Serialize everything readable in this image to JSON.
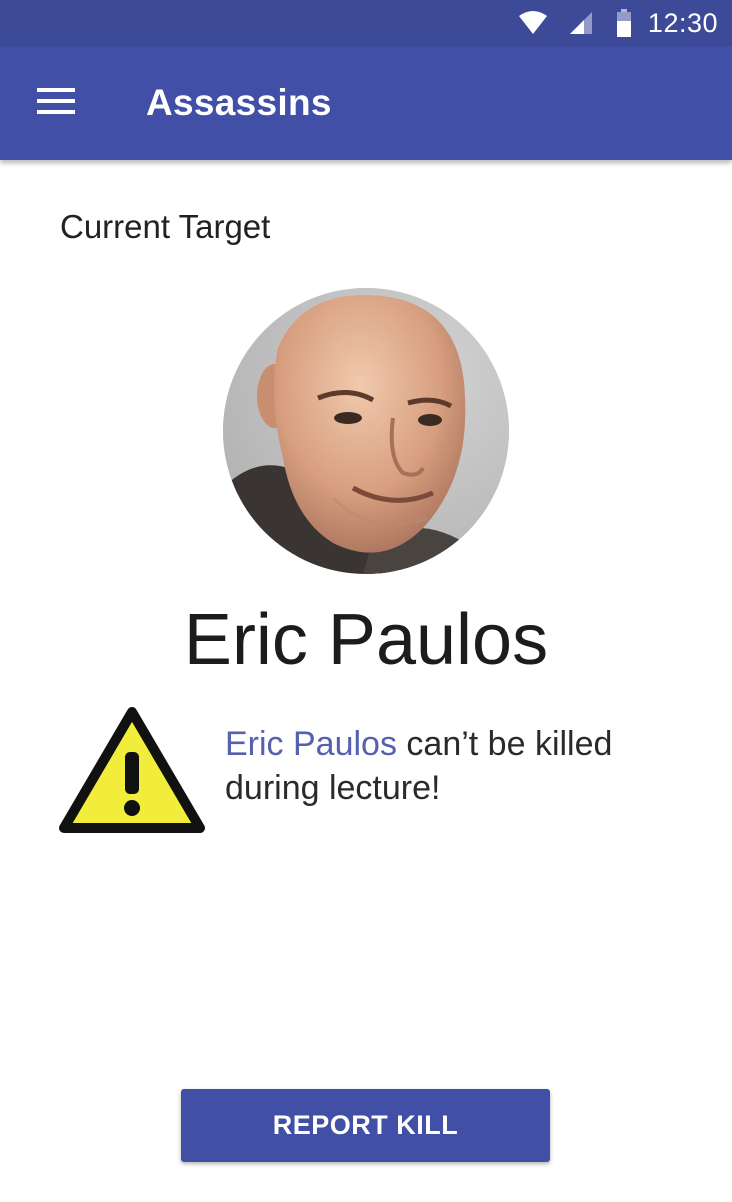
{
  "status_bar": {
    "time": "12:30",
    "icons": [
      "wifi-icon",
      "signal-icon",
      "battery-icon"
    ]
  },
  "app_bar": {
    "title": "Assassins",
    "menu_icon": "menu-icon"
  },
  "main": {
    "section_label": "Current Target",
    "target": {
      "name": "Eric Paulos"
    },
    "warning": {
      "icon": "warning-icon",
      "name": "Eric Paulos",
      "message": " can’t be killed during lecture!"
    },
    "report_button": {
      "label": "REPORT KILL"
    }
  },
  "colors": {
    "status_bar": "#3c4a98",
    "app_bar": "#4150a6",
    "accent_text": "#5560ae",
    "warning_fill": "#f2ec3a",
    "warning_stroke": "#111111"
  }
}
